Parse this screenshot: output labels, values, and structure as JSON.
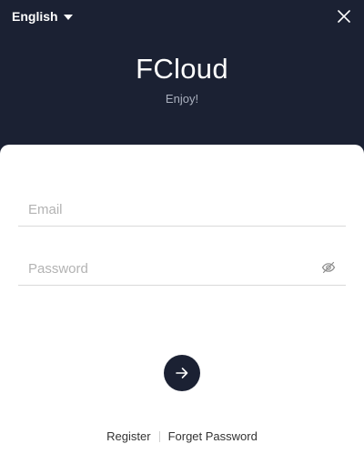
{
  "header": {
    "language": "English",
    "brand": "FCloud",
    "tagline": "Enjoy!"
  },
  "form": {
    "email_placeholder": "Email",
    "email_value": "",
    "password_placeholder": "Password",
    "password_value": ""
  },
  "links": {
    "register": "Register",
    "forget_password": "Forget Password"
  },
  "icons": {
    "language_caret": "caret-down-icon",
    "close": "close-icon",
    "password_toggle": "eye-off-icon",
    "submit": "arrow-right-icon"
  },
  "colors": {
    "header_bg": "#1b2133",
    "card_bg": "#ffffff",
    "accent": "#1b2133",
    "muted_text": "#aab0be"
  }
}
